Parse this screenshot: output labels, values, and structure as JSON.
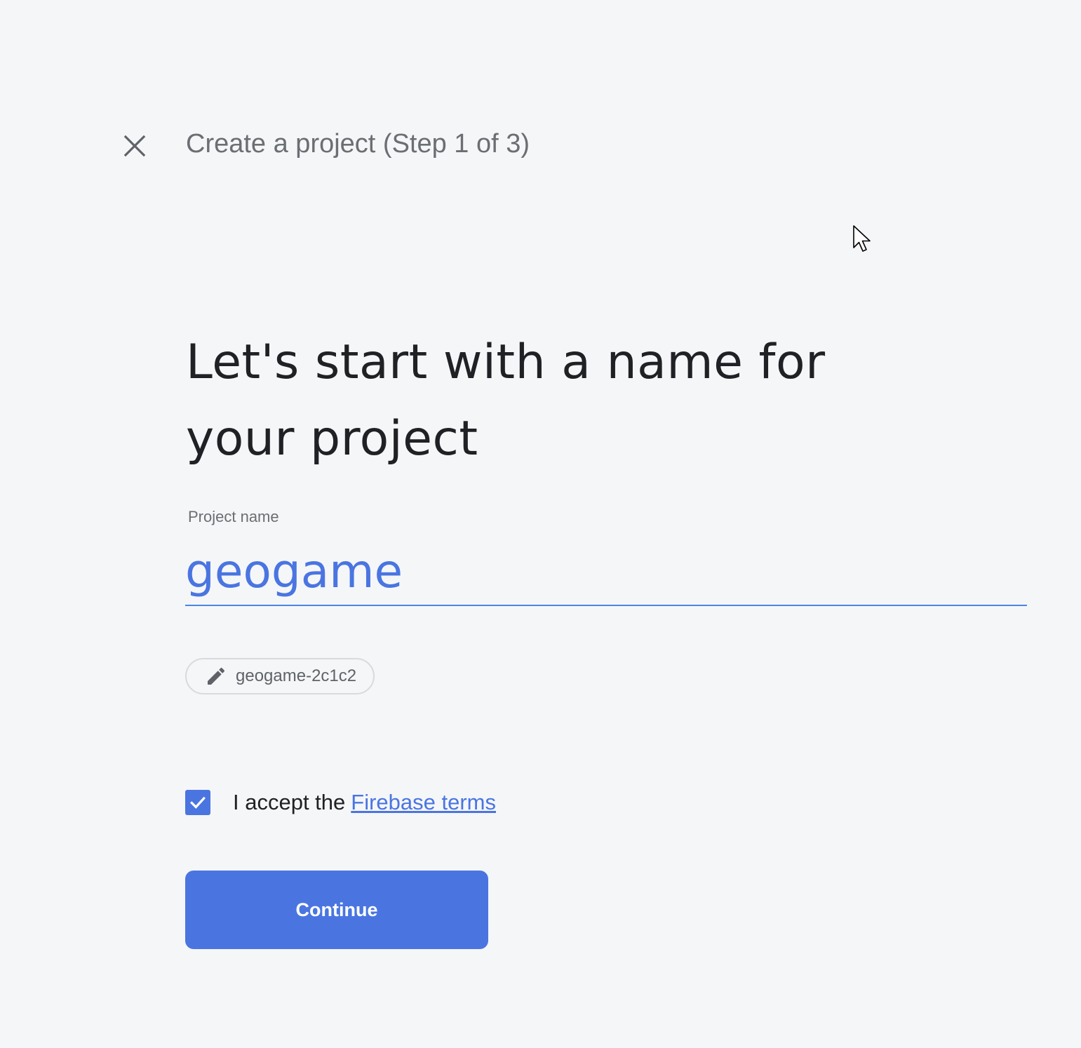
{
  "header": {
    "close_icon": "close-icon",
    "step_title": "Create a project (Step 1 of 3)"
  },
  "main": {
    "headline": "Let's start with a name for your project",
    "project_name_label": "Project name",
    "project_name_value": "geogame",
    "project_id_icon": "pencil-icon",
    "project_id": "geogame-2c1c2",
    "terms_checkbox_checked": true,
    "terms_prefix": "I accept the",
    "terms_link": "Firebase terms",
    "continue_label": "Continue"
  },
  "colors": {
    "background": "#f5f6f8",
    "accent": "#4a75e1",
    "underline": "#4a85e6",
    "text_primary": "#202124",
    "text_secondary": "#6b6e72"
  }
}
